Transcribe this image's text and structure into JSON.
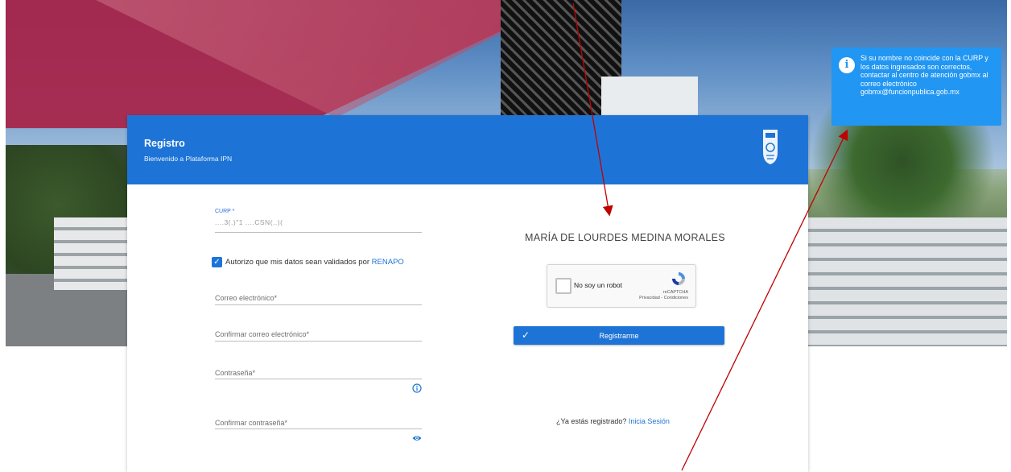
{
  "info_box": {
    "text": "Si su nombre no coincide con la CURP y los datos ingresados son correctos, contactar al centro de atención gobmx al correo electrónico gobmx@funcionpublica.gob.mx",
    "icon": "info-icon"
  },
  "header": {
    "title": "Registro",
    "subtitle": "Bienvenido a Plataforma IPN"
  },
  "form": {
    "curp_label": "CURP *",
    "curp_value": "....3(.)\"1  ....CSN(..)(",
    "authorize_text": "Autorizo que mis datos sean validados por",
    "authorize_link": "RENAPO",
    "email_placeholder": "Correo electrónico*",
    "confirm_email_placeholder": "Confirmar correo electrónico*",
    "password_placeholder": "Contraseña*",
    "confirm_password_placeholder": "Confirmar contraseña*"
  },
  "right_panel": {
    "full_name": "MARÍA DE LOURDES MEDINA MORALES",
    "recaptcha_label": "No soy un robot",
    "recaptcha_brand": "reCAPTCHA",
    "recaptcha_links": "Privacidad - Condiciones",
    "register_button": "Registrarme",
    "login_prompt": "¿Ya estás registrado?",
    "login_link": "Inicia Sesión"
  },
  "colors": {
    "primary": "#1e74d6",
    "info": "#2196f3",
    "annotation": "#c00000"
  }
}
